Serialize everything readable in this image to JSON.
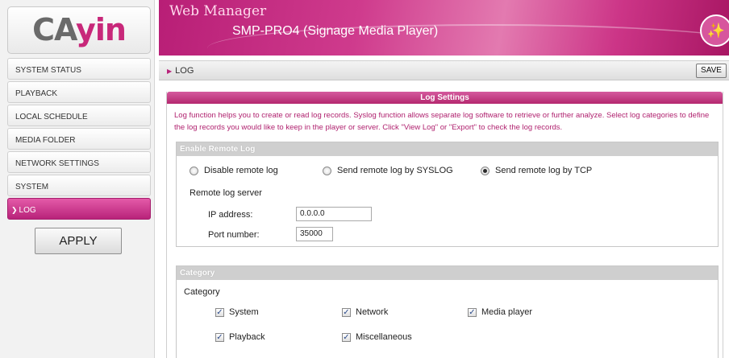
{
  "logo": {
    "text_main": "CA",
    "text_accent": "yin"
  },
  "sidebar": {
    "items": [
      {
        "label": "SYSTEM STATUS"
      },
      {
        "label": "PLAYBACK"
      },
      {
        "label": "LOCAL SCHEDULE"
      },
      {
        "label": "MEDIA FOLDER"
      },
      {
        "label": "NETWORK SETTINGS"
      },
      {
        "label": "SYSTEM"
      },
      {
        "label": "LOG",
        "active": true
      }
    ],
    "apply_label": "APPLY"
  },
  "header": {
    "title": "Web Manager",
    "subtitle": "SMP-PRO4 (Signage Media Player)"
  },
  "breadcrumb": {
    "label": "LOG",
    "save_label": "SAVE"
  },
  "panel": {
    "title": "Log Settings",
    "description": "Log function helps you to create or read log records. Syslog function allows separate log software to retrieve or further analyze. Select log categories to define the log records you would like to keep in the player or server. Click \"View Log\" or \"Export\" to check the log records."
  },
  "remote_log": {
    "heading": "Enable Remote Log",
    "options": [
      {
        "label": "Disable remote log",
        "checked": false
      },
      {
        "label": "Send remote log by SYSLOG",
        "checked": false
      },
      {
        "label": "Send remote log by TCP",
        "checked": true
      }
    ],
    "server_label": "Remote log server",
    "ip_label": "IP address:",
    "ip_value": "0.0.0.0",
    "port_label": "Port number:",
    "port_value": "35000"
  },
  "category": {
    "heading": "Category",
    "label": "Category",
    "items": [
      {
        "label": "System",
        "checked": true
      },
      {
        "label": "Network",
        "checked": true
      },
      {
        "label": "Media player",
        "checked": true
      },
      {
        "label": "Playback",
        "checked": true
      },
      {
        "label": "Miscellaneous",
        "checked": true
      }
    ]
  },
  "colors": {
    "accent": "#b8237a",
    "section_head": "#cfcfcf"
  }
}
